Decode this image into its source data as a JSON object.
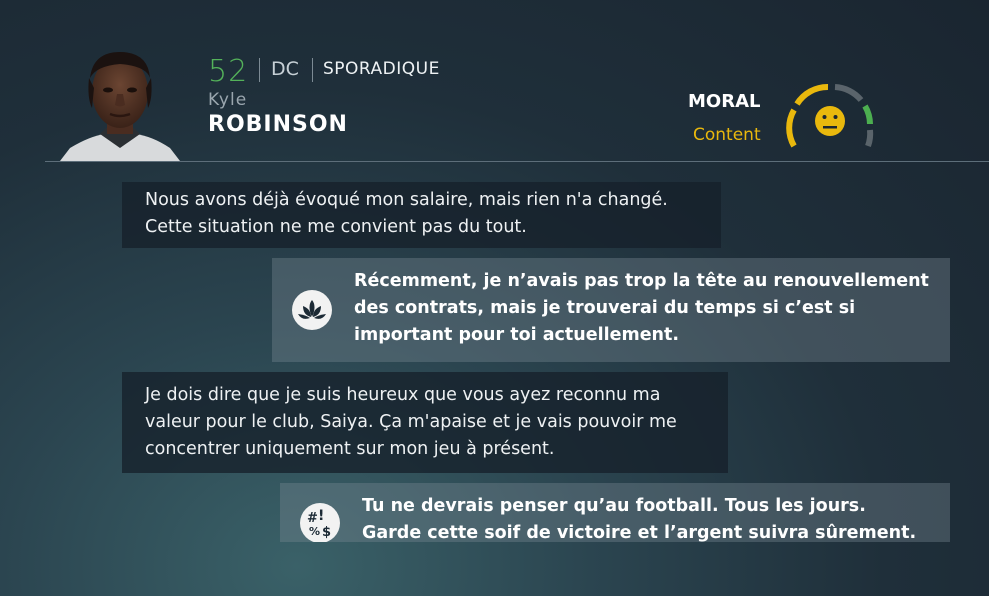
{
  "player": {
    "rating": "52",
    "position": "DC",
    "status": "SPORADIQUE",
    "first_name": "Kyle",
    "last_name": "ROBINSON"
  },
  "morale": {
    "label": "MORAL",
    "value": "Content",
    "icon": "neutral-face-icon",
    "colors": {
      "low": "#e9b80d",
      "mid": "#5a646b",
      "high": "#4caf50"
    }
  },
  "messages": [
    {
      "speaker": "player",
      "text": "Nous avons déjà évoqué mon salaire, mais rien n'a changé. Cette situation ne me convient pas du tout."
    },
    {
      "speaker": "manager",
      "icon": "lotus-icon",
      "text": "Récemment, je n’avais pas trop la tête au renouvellement des contrats, mais je trouverai du temps si c’est si important pour toi actuellement."
    },
    {
      "speaker": "player",
      "text": "Je dois dire que je suis heureux que vous ayez reconnu ma valeur pour le club, Saiya. Ça m'apaise et je vais pouvoir me concentrer uniquement sur mon jeu à présent."
    },
    {
      "speaker": "manager",
      "icon": "symbols-icon",
      "text": "Tu ne devrais penser qu’au football. Tous les jours. Garde cette soif de victoire et l’argent suivra sûrement."
    }
  ]
}
